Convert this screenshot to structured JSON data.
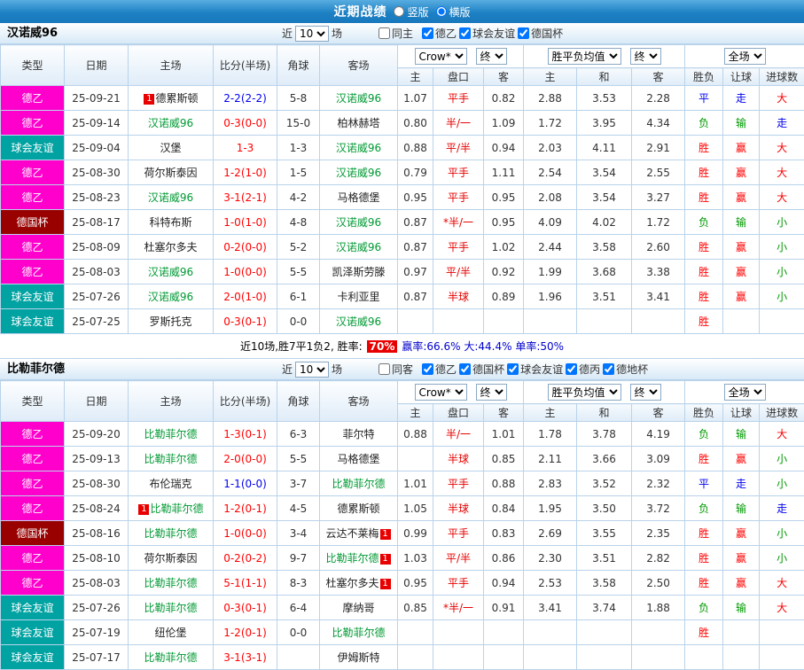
{
  "top_bar": {
    "title": "近期战绩",
    "options": [
      {
        "label": "竖版",
        "selected": false
      },
      {
        "label": "横版",
        "selected": true
      }
    ]
  },
  "table_header": {
    "cols": [
      "类型",
      "日期",
      "主场",
      "比分(半场)",
      "角球",
      "客场"
    ],
    "subcols": [
      "主",
      "盘口",
      "客",
      "主",
      "和",
      "客",
      "胜负",
      "让球",
      "进球数"
    ],
    "bookmaker": "Crow*",
    "final_label": "终",
    "avg_label": "胜平负均值",
    "full_label": "全场"
  },
  "colors": {
    "league_types": {
      "德乙": "#ff00cc",
      "球会友谊": "#00a2a2",
      "德国杯": "#990000"
    },
    "outcome": {
      "red": "#ff0000",
      "blue": "#0000ee",
      "green": "#009900",
      "": ""
    },
    "team_highlight": "#009933",
    "team_normal": "#222222",
    "handicap_text": "#e60000",
    "win_rate_badge_bg": "#e80000",
    "summary_stats_text": "#0000cc"
  },
  "sections": [
    {
      "team": "汉诺威96",
      "filter": {
        "near_label": "近",
        "count": "10",
        "games_label": "场",
        "same": {
          "label": "同主",
          "checked": false
        },
        "leagues": [
          {
            "label": "德乙",
            "checked": true
          },
          {
            "label": "球会友谊",
            "checked": true
          },
          {
            "label": "德国杯",
            "checked": true
          }
        ]
      },
      "rows": [
        {
          "type": "德乙",
          "date": "25-09-21",
          "home": {
            "name": "德累斯顿",
            "badge_pre": "1"
          },
          "score": {
            "text": "2-2(2-2)",
            "color": "blue"
          },
          "corner": "5-8",
          "away": {
            "name": "汉诺威96",
            "subject": true
          },
          "odds": {
            "home": "1.07",
            "handicap": "平手",
            "away": "0.82"
          },
          "europe": {
            "win": "2.88",
            "draw": "3.53",
            "lose": "2.28"
          },
          "results": [
            {
              "text": "平",
              "color": "blue"
            },
            {
              "text": "走",
              "color": "blue"
            },
            {
              "text": "大",
              "color": "red"
            }
          ]
        },
        {
          "type": "德乙",
          "date": "25-09-14",
          "home": {
            "name": "汉诺威96",
            "subject": true
          },
          "score": {
            "text": "0-3(0-0)",
            "color": "red"
          },
          "corner": "15-0",
          "away": {
            "name": "柏林赫塔"
          },
          "odds": {
            "home": "0.80",
            "handicap": "半/一",
            "away": "1.09"
          },
          "europe": {
            "win": "1.72",
            "draw": "3.95",
            "lose": "4.34"
          },
          "results": [
            {
              "text": "负",
              "color": "green"
            },
            {
              "text": "输",
              "color": "green"
            },
            {
              "text": "走",
              "color": "blue"
            }
          ]
        },
        {
          "type": "球会友谊",
          "date": "25-09-04",
          "home": {
            "name": "汉堡"
          },
          "score": {
            "text": "1-3",
            "color": "red"
          },
          "corner": "1-3",
          "away": {
            "name": "汉诺威96",
            "subject": true
          },
          "odds": {
            "home": "0.88",
            "handicap": "平/半",
            "away": "0.94"
          },
          "europe": {
            "win": "2.03",
            "draw": "4.11",
            "lose": "2.91"
          },
          "results": [
            {
              "text": "胜",
              "color": "red"
            },
            {
              "text": "赢",
              "color": "red"
            },
            {
              "text": "大",
              "color": "red"
            }
          ]
        },
        {
          "type": "德乙",
          "date": "25-08-30",
          "home": {
            "name": "荷尔斯泰因"
          },
          "score": {
            "text": "1-2(1-0)",
            "color": "red"
          },
          "corner": "1-5",
          "away": {
            "name": "汉诺威96",
            "subject": true
          },
          "odds": {
            "home": "0.79",
            "handicap": "平手",
            "away": "1.11"
          },
          "europe": {
            "win": "2.54",
            "draw": "3.54",
            "lose": "2.55"
          },
          "results": [
            {
              "text": "胜",
              "color": "red"
            },
            {
              "text": "赢",
              "color": "red"
            },
            {
              "text": "大",
              "color": "red"
            }
          ]
        },
        {
          "type": "德乙",
          "date": "25-08-23",
          "home": {
            "name": "汉诺威96",
            "subject": true
          },
          "score": {
            "text": "3-1(2-1)",
            "color": "red"
          },
          "corner": "4-2",
          "away": {
            "name": "马格德堡"
          },
          "odds": {
            "home": "0.95",
            "handicap": "平手",
            "away": "0.95"
          },
          "europe": {
            "win": "2.08",
            "draw": "3.54",
            "lose": "3.27"
          },
          "results": [
            {
              "text": "胜",
              "color": "red"
            },
            {
              "text": "赢",
              "color": "red"
            },
            {
              "text": "大",
              "color": "red"
            }
          ]
        },
        {
          "type": "德国杯",
          "date": "25-08-17",
          "home": {
            "name": "科特布斯"
          },
          "score": {
            "text": "1-0(1-0)",
            "color": "red"
          },
          "corner": "4-8",
          "away": {
            "name": "汉诺威96",
            "subject": true
          },
          "odds": {
            "home": "0.87",
            "handicap": "*半/一",
            "away": "0.95"
          },
          "europe": {
            "win": "4.09",
            "draw": "4.02",
            "lose": "1.72"
          },
          "results": [
            {
              "text": "负",
              "color": "green"
            },
            {
              "text": "输",
              "color": "green"
            },
            {
              "text": "小",
              "color": "green"
            }
          ]
        },
        {
          "type": "德乙",
          "date": "25-08-09",
          "home": {
            "name": "杜塞尔多夫"
          },
          "score": {
            "text": "0-2(0-0)",
            "color": "red"
          },
          "corner": "5-2",
          "away": {
            "name": "汉诺威96",
            "subject": true
          },
          "odds": {
            "home": "0.87",
            "handicap": "平手",
            "away": "1.02"
          },
          "europe": {
            "win": "2.44",
            "draw": "3.58",
            "lose": "2.60"
          },
          "results": [
            {
              "text": "胜",
              "color": "red"
            },
            {
              "text": "赢",
              "color": "red"
            },
            {
              "text": "小",
              "color": "green"
            }
          ]
        },
        {
          "type": "德乙",
          "date": "25-08-03",
          "home": {
            "name": "汉诺威96",
            "subject": true
          },
          "score": {
            "text": "1-0(0-0)",
            "color": "red"
          },
          "corner": "5-5",
          "away": {
            "name": "凯泽斯劳滕"
          },
          "odds": {
            "home": "0.97",
            "handicap": "平/半",
            "away": "0.92"
          },
          "europe": {
            "win": "1.99",
            "draw": "3.68",
            "lose": "3.38"
          },
          "results": [
            {
              "text": "胜",
              "color": "red"
            },
            {
              "text": "赢",
              "color": "red"
            },
            {
              "text": "小",
              "color": "green"
            }
          ]
        },
        {
          "type": "球会友谊",
          "date": "25-07-26",
          "home": {
            "name": "汉诺威96",
            "subject": true
          },
          "score": {
            "text": "2-0(1-0)",
            "color": "red"
          },
          "corner": "6-1",
          "away": {
            "name": "卡利亚里"
          },
          "odds": {
            "home": "0.87",
            "handicap": "半球",
            "away": "0.89"
          },
          "europe": {
            "win": "1.96",
            "draw": "3.51",
            "lose": "3.41"
          },
          "results": [
            {
              "text": "胜",
              "color": "red"
            },
            {
              "text": "赢",
              "color": "red"
            },
            {
              "text": "小",
              "color": "green"
            }
          ]
        },
        {
          "type": "球会友谊",
          "date": "25-07-25",
          "home": {
            "name": "罗斯托克"
          },
          "score": {
            "text": "0-3(0-1)",
            "color": "red"
          },
          "corner": "0-0",
          "away": {
            "name": "汉诺威96",
            "subject": true
          },
          "odds": {
            "home": "",
            "handicap": "",
            "away": ""
          },
          "europe": {
            "win": "",
            "draw": "",
            "lose": ""
          },
          "results": [
            {
              "text": "胜",
              "color": "red"
            },
            {
              "text": "",
              "color": ""
            },
            {
              "text": "",
              "color": ""
            }
          ]
        }
      ],
      "summary": {
        "prefix": "近10场,胜7平1负2, 胜率:",
        "win_rate": "70%",
        "stats": "赢率:66.6% 大:44.4% 单率:50%"
      }
    },
    {
      "team": "比勒菲尔德",
      "filter": {
        "near_label": "近",
        "count": "10",
        "games_label": "场",
        "same": {
          "label": "同客",
          "checked": false
        },
        "leagues": [
          {
            "label": "德乙",
            "checked": true
          },
          {
            "label": "德国杯",
            "checked": true
          },
          {
            "label": "球会友谊",
            "checked": true
          },
          {
            "label": "德丙",
            "checked": true
          },
          {
            "label": "德地杯",
            "checked": true
          }
        ]
      },
      "rows": [
        {
          "type": "德乙",
          "date": "25-09-20",
          "home": {
            "name": "比勒菲尔德",
            "subject": true
          },
          "score": {
            "text": "1-3(0-1)",
            "color": "red"
          },
          "corner": "6-3",
          "away": {
            "name": "菲尔特"
          },
          "odds": {
            "home": "0.88",
            "handicap": "半/一",
            "away": "1.01"
          },
          "europe": {
            "win": "1.78",
            "draw": "3.78",
            "lose": "4.19"
          },
          "results": [
            {
              "text": "负",
              "color": "green"
            },
            {
              "text": "输",
              "color": "green"
            },
            {
              "text": "大",
              "color": "red"
            }
          ]
        },
        {
          "type": "德乙",
          "date": "25-09-13",
          "home": {
            "name": "比勒菲尔德",
            "subject": true
          },
          "score": {
            "text": "2-0(0-0)",
            "color": "red"
          },
          "corner": "5-5",
          "away": {
            "name": "马格德堡"
          },
          "odds": {
            "home": "",
            "handicap": "半球",
            "away": "0.85"
          },
          "europe": {
            "win": "2.11",
            "draw": "3.66",
            "lose": "3.09"
          },
          "results": [
            {
              "text": "胜",
              "color": "red"
            },
            {
              "text": "赢",
              "color": "red"
            },
            {
              "text": "小",
              "color": "green"
            }
          ]
        },
        {
          "type": "德乙",
          "date": "25-08-30",
          "home": {
            "name": "布伦瑞克"
          },
          "score": {
            "text": "1-1(0-0)",
            "color": "blue"
          },
          "corner": "3-7",
          "away": {
            "name": "比勒菲尔德",
            "subject": true
          },
          "odds": {
            "home": "1.01",
            "handicap": "平手",
            "away": "0.88"
          },
          "europe": {
            "win": "2.83",
            "draw": "3.52",
            "lose": "2.32"
          },
          "results": [
            {
              "text": "平",
              "color": "blue"
            },
            {
              "text": "走",
              "color": "blue"
            },
            {
              "text": "小",
              "color": "green"
            }
          ]
        },
        {
          "type": "德乙",
          "date": "25-08-24",
          "home": {
            "name": "比勒菲尔德",
            "subject": true,
            "badge_pre": "1"
          },
          "score": {
            "text": "1-2(0-1)",
            "color": "red"
          },
          "corner": "4-5",
          "away": {
            "name": "德累斯顿"
          },
          "odds": {
            "home": "1.05",
            "handicap": "半球",
            "away": "0.84"
          },
          "europe": {
            "win": "1.95",
            "draw": "3.50",
            "lose": "3.72"
          },
          "results": [
            {
              "text": "负",
              "color": "green"
            },
            {
              "text": "输",
              "color": "green"
            },
            {
              "text": "走",
              "color": "blue"
            }
          ]
        },
        {
          "type": "德国杯",
          "date": "25-08-16",
          "home": {
            "name": "比勒菲尔德",
            "subject": true
          },
          "score": {
            "text": "1-0(0-0)",
            "color": "red"
          },
          "corner": "3-4",
          "away": {
            "name": "云达不莱梅",
            "badge_post": "1"
          },
          "odds": {
            "home": "0.99",
            "handicap": "平手",
            "away": "0.83"
          },
          "europe": {
            "win": "2.69",
            "draw": "3.55",
            "lose": "2.35"
          },
          "results": [
            {
              "text": "胜",
              "color": "red"
            },
            {
              "text": "赢",
              "color": "red"
            },
            {
              "text": "小",
              "color": "green"
            }
          ]
        },
        {
          "type": "德乙",
          "date": "25-08-10",
          "home": {
            "name": "荷尔斯泰因"
          },
          "score": {
            "text": "0-2(0-2)",
            "color": "red"
          },
          "corner": "9-7",
          "away": {
            "name": "比勒菲尔德",
            "subject": true,
            "badge_post": "1"
          },
          "odds": {
            "home": "1.03",
            "handicap": "平/半",
            "away": "0.86"
          },
          "europe": {
            "win": "2.30",
            "draw": "3.51",
            "lose": "2.82"
          },
          "results": [
            {
              "text": "胜",
              "color": "red"
            },
            {
              "text": "赢",
              "color": "red"
            },
            {
              "text": "小",
              "color": "green"
            }
          ]
        },
        {
          "type": "德乙",
          "date": "25-08-03",
          "home": {
            "name": "比勒菲尔德",
            "subject": true
          },
          "score": {
            "text": "5-1(1-1)",
            "color": "red"
          },
          "corner": "8-3",
          "away": {
            "name": "杜塞尔多夫",
            "badge_post": "1"
          },
          "odds": {
            "home": "0.95",
            "handicap": "平手",
            "away": "0.94"
          },
          "europe": {
            "win": "2.53",
            "draw": "3.58",
            "lose": "2.50"
          },
          "results": [
            {
              "text": "胜",
              "color": "red"
            },
            {
              "text": "赢",
              "color": "red"
            },
            {
              "text": "大",
              "color": "red"
            }
          ]
        },
        {
          "type": "球会友谊",
          "date": "25-07-26",
          "home": {
            "name": "比勒菲尔德",
            "subject": true
          },
          "score": {
            "text": "0-3(0-1)",
            "color": "red"
          },
          "corner": "6-4",
          "away": {
            "name": "摩纳哥"
          },
          "odds": {
            "home": "0.85",
            "handicap": "*半/一",
            "away": "0.91"
          },
          "europe": {
            "win": "3.41",
            "draw": "3.74",
            "lose": "1.88"
          },
          "results": [
            {
              "text": "负",
              "color": "green"
            },
            {
              "text": "输",
              "color": "green"
            },
            {
              "text": "大",
              "color": "red"
            }
          ]
        },
        {
          "type": "球会友谊",
          "date": "25-07-19",
          "home": {
            "name": "纽伦堡"
          },
          "score": {
            "text": "1-2(0-1)",
            "color": "red"
          },
          "corner": "0-0",
          "away": {
            "name": "比勒菲尔德",
            "subject": true
          },
          "odds": {
            "home": "",
            "handicap": "",
            "away": ""
          },
          "europe": {
            "win": "",
            "draw": "",
            "lose": ""
          },
          "results": [
            {
              "text": "胜",
              "color": "red"
            },
            {
              "text": "",
              "color": ""
            },
            {
              "text": "",
              "color": ""
            }
          ]
        },
        {
          "type": "球会友谊",
          "date": "25-07-17",
          "home": {
            "name": "比勒菲尔德",
            "subject": true
          },
          "score": {
            "text": "3-1(3-1)",
            "color": "red"
          },
          "corner": "",
          "away": {
            "name": "伊姆斯特"
          },
          "odds": {
            "home": "",
            "handicap": "",
            "away": ""
          },
          "europe": {
            "win": "",
            "draw": "",
            "lose": ""
          },
          "results": [
            {
              "text": "",
              "color": ""
            },
            {
              "text": "",
              "color": ""
            },
            {
              "text": "",
              "color": ""
            }
          ]
        }
      ]
    }
  ]
}
